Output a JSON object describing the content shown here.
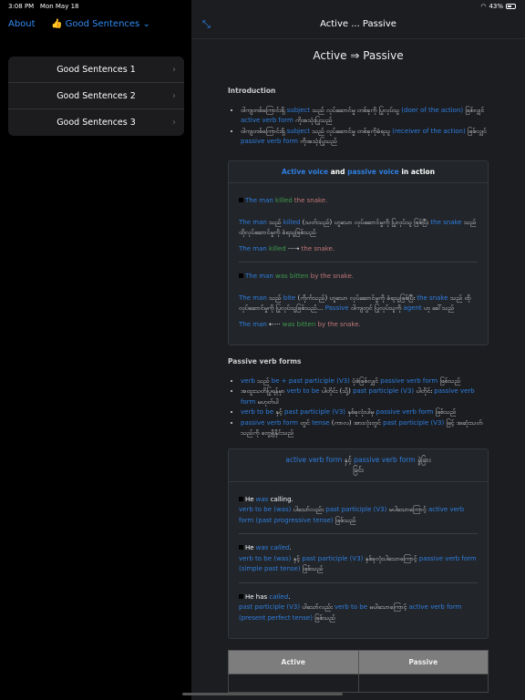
{
  "status": {
    "time": "3:08 PM",
    "date": "Mon May 18",
    "battery": "43%"
  },
  "sidebar": {
    "about": "About",
    "menu_emoji": "👍",
    "menu_title": "Good Sentences",
    "items": [
      {
        "label": "Good Sentences 1"
      },
      {
        "label": "Good Sentences 2"
      },
      {
        "label": "Good Sentences 3"
      }
    ]
  },
  "detail": {
    "nav_title": "Active ... Passive",
    "page_title": "Active ⇒ Passive",
    "intro_heading": "Introduction",
    "intro": [
      [
        {
          "t": "ဝါကျတစ်ကြောင်းရှိ ",
          "c": "w"
        },
        {
          "t": "subject",
          "c": "b"
        },
        {
          "t": " သည် လုပ်ဆောင်မှု တစ်ခုကို ပြုလုပ်သူ ",
          "c": "w"
        },
        {
          "t": "(doer of the action)",
          "c": "b"
        },
        {
          "t": " ဖြစ်လျှင် ",
          "c": "w"
        },
        {
          "t": "active verb form",
          "c": "b"
        },
        {
          "t": " ကိုအသုံးပြုသည်",
          "c": "w"
        }
      ],
      [
        {
          "t": "ဝါကျတစ်ကြောင်းရှိ ",
          "c": "w"
        },
        {
          "t": "subject",
          "c": "b"
        },
        {
          "t": " သည် လုပ်ဆောင်မှု တစ်ခုကိုခံရသူ ",
          "c": "w"
        },
        {
          "t": "(receiver of the action)",
          "c": "b"
        },
        {
          "t": " ဖြစ်လျှင် ",
          "c": "w"
        },
        {
          "t": "passive verb form",
          "c": "b"
        },
        {
          "t": " ကိုအသုံးပြုသည်",
          "c": "w"
        }
      ]
    ],
    "card1_header": [
      {
        "t": "Active voice",
        "c": "b"
      },
      {
        "t": " and ",
        "c": "bw"
      },
      {
        "t": "passive voice",
        "c": "b"
      },
      {
        "t": " in action",
        "c": "bw"
      }
    ],
    "card1_examples": [
      {
        "sentence": [
          {
            "t": "The man",
            "c": "b"
          },
          {
            "t": " killed",
            "c": "g"
          },
          {
            "t": " the snake.",
            "c": "r"
          }
        ],
        "explain": [
          {
            "t": "The man",
            "c": "b"
          },
          {
            "t": " သည် ",
            "c": "w"
          },
          {
            "t": "killed",
            "c": "b"
          },
          {
            "t": " (သတ်သည်) ဟူသော လုပ်ဆောင်မှုကို ပြုလုပ်သူ ဖြစ်ပြီး ",
            "c": "w"
          },
          {
            "t": "the snake",
            "c": "b"
          },
          {
            "t": " သည် ထိုလုပ်ဆောင်မှုကို ခံရသူဖြစ်သည်",
            "c": "w"
          }
        ],
        "diagram": [
          {
            "t": "The man",
            "c": "b"
          },
          {
            "t": " killed ",
            "c": "g"
          },
          {
            "t": "···➝ ",
            "c": "bw"
          },
          {
            "t": "the snake.",
            "c": "r"
          }
        ]
      },
      {
        "sentence": [
          {
            "t": "The man",
            "c": "b"
          },
          {
            "t": " was bitten",
            "c": "g"
          },
          {
            "t": " by the snake.",
            "c": "r"
          }
        ],
        "explain": [
          {
            "t": "The man",
            "c": "b"
          },
          {
            "t": " သည် ",
            "c": "w"
          },
          {
            "t": "bite",
            "c": "b"
          },
          {
            "t": " (ကိုက်သည်) ဟူသော လုပ်ဆောင်မှုကို ခံရသူဖြစ်ပြီး ",
            "c": "w"
          },
          {
            "t": "the snake",
            "c": "b"
          },
          {
            "t": " သည် ထိုလုပ်ဆောင်မှုကို ပြုလုပ်သူဖြစ်သည်... ",
            "c": "w"
          },
          {
            "t": "Passive",
            "c": "b"
          },
          {
            "t": " ဝါကျတွင် ပြုလုပ်သူကို ",
            "c": "w"
          },
          {
            "t": "agent",
            "c": "b"
          },
          {
            "t": " ဟု ခေါ်သည်",
            "c": "w"
          }
        ],
        "diagram": [
          {
            "t": "The man ",
            "c": "b"
          },
          {
            "t": "⇠··· ",
            "c": "bw"
          },
          {
            "t": "was bitten",
            "c": "g"
          },
          {
            "t": " by the snake.",
            "c": "r"
          }
        ]
      }
    ],
    "pvf_heading": "Passive verb forms",
    "pvf": [
      [
        {
          "t": "verb",
          "c": "b"
        },
        {
          "t": " သည် ",
          "c": "w"
        },
        {
          "t": "be + past participle (V3)",
          "c": "b"
        },
        {
          "t": " ပုံစံဖြစ်လျှင် ",
          "c": "w"
        },
        {
          "t": "passive verb form",
          "c": "b"
        },
        {
          "t": " ဖြစ်သည်",
          "c": "w"
        }
      ],
      [
        {
          "t": "အထူးသတိပြုရန်မှာ ",
          "c": "w"
        },
        {
          "t": "verb to be",
          "c": "b"
        },
        {
          "t": " ပါတိုင်း (သို့) ",
          "c": "w"
        },
        {
          "t": "past participle (V3)",
          "c": "b"
        },
        {
          "t": " ပါတိုင်း ",
          "c": "w"
        },
        {
          "t": "passive verb form",
          "c": "b"
        },
        {
          "t": " မဟုတ်ပါ",
          "c": "w"
        }
      ],
      [
        {
          "t": "verb to be",
          "c": "b"
        },
        {
          "t": " နှင့် ",
          "c": "w"
        },
        {
          "t": "past participle (V3)",
          "c": "b"
        },
        {
          "t": " နှစ်ခုလုံးပါမှ ",
          "c": "w"
        },
        {
          "t": "passive verb form",
          "c": "b"
        },
        {
          "t": " ဖြစ်သည်",
          "c": "w"
        }
      ],
      [
        {
          "t": "passive verb form",
          "c": "b"
        },
        {
          "t": " တွင် ",
          "c": "w"
        },
        {
          "t": "tense",
          "c": "b"
        },
        {
          "t": " (ကာလ) အားလုံးတွင် ",
          "c": "w"
        },
        {
          "t": "past participle (V3)",
          "c": "b"
        },
        {
          "t": " ဖြင့် အဆုံးသတ်သည်ကို တွေ့ရှိနိုင်သည်",
          "c": "w"
        }
      ]
    ],
    "card2_header": [
      {
        "t": "active verb form",
        "c": "b"
      },
      {
        "t": " နှင့် ",
        "c": "w"
      },
      {
        "t": "passive verb form",
        "c": "b"
      },
      {
        "t": " ခွဲခြားခြင်း",
        "c": "w"
      }
    ],
    "card2_examples": [
      {
        "sentence": [
          {
            "t": "He ",
            "c": "bw"
          },
          {
            "t": "was",
            "c": "i"
          },
          {
            "t": " calling.",
            "c": "bw"
          }
        ],
        "explain": [
          {
            "t": "verb to be (was)",
            "c": "b"
          },
          {
            "t": " ပါသော်လည်း ",
            "c": "w"
          },
          {
            "t": "past participle (V3)",
            "c": "b"
          },
          {
            "t": " မပါသောကြောင့် ",
            "c": "w"
          },
          {
            "t": "active verb form (past progressive tense)",
            "c": "b"
          },
          {
            "t": " ဖြစ်သည်",
            "c": "w"
          }
        ]
      },
      {
        "sentence": [
          {
            "t": "He ",
            "c": "bw"
          },
          {
            "t": "was called",
            "c": "i"
          },
          {
            "t": ".",
            "c": "bw"
          }
        ],
        "explain": [
          {
            "t": "verb to be (was)",
            "c": "b"
          },
          {
            "t": " နှင့် ",
            "c": "w"
          },
          {
            "t": "past participle (V3)",
            "c": "b"
          },
          {
            "t": " နှစ်ခုလုံးပါသောကြောင့် ",
            "c": "w"
          },
          {
            "t": "passive verb form (simple past tense)",
            "c": "b"
          },
          {
            "t": " ဖြစ်သည်",
            "c": "w"
          }
        ]
      },
      {
        "sentence": [
          {
            "t": "He has ",
            "c": "bw"
          },
          {
            "t": "called",
            "c": "i"
          },
          {
            "t": ".",
            "c": "bw"
          }
        ],
        "explain": [
          {
            "t": "past participle (V3)",
            "c": "b"
          },
          {
            "t": " ပါသော်လည်း ",
            "c": "w"
          },
          {
            "t": "verb to be",
            "c": "b"
          },
          {
            "t": " မပါသောကြောင့် ",
            "c": "w"
          },
          {
            "t": "active verb form (present perfect tense)",
            "c": "b"
          },
          {
            "t": " ဖြစ်သည်",
            "c": "w"
          }
        ]
      }
    ],
    "table_headers": [
      "Active",
      "Passive"
    ]
  },
  "colors": {
    "accent": "#2f8cf5",
    "blue_text": "#2f7fe0",
    "green_text": "#3e9a4b",
    "red_text": "#c27878"
  }
}
